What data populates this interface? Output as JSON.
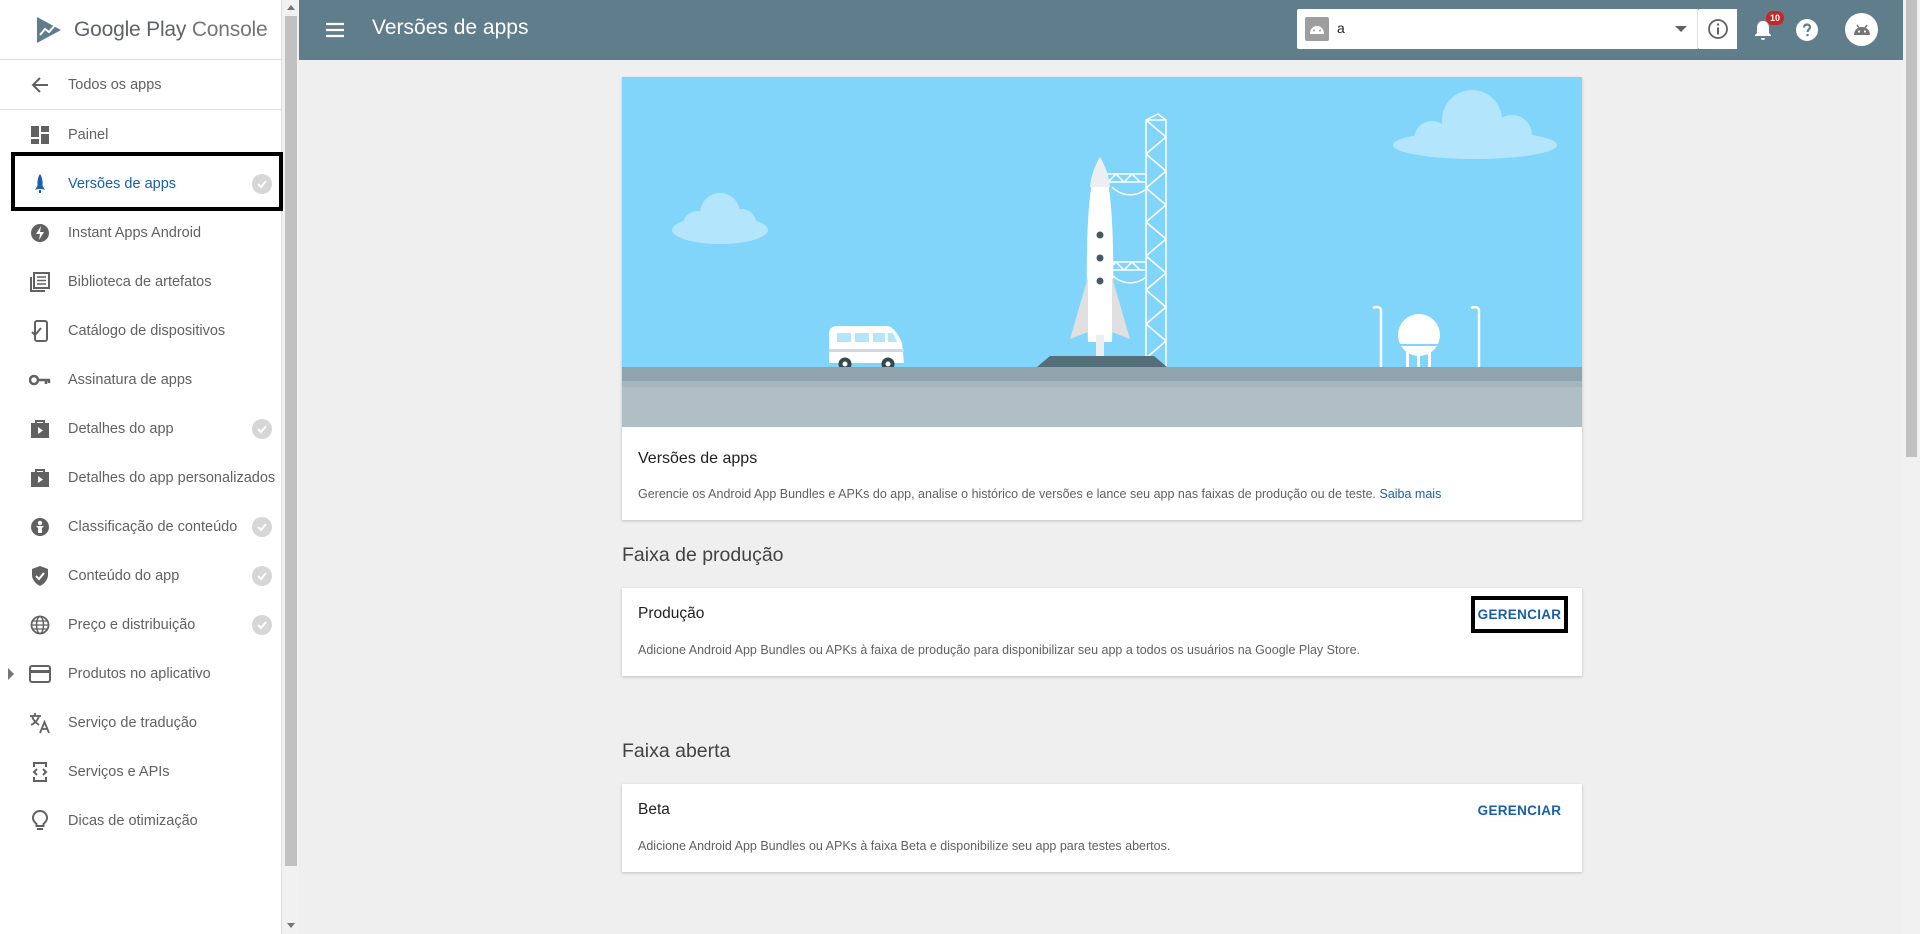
{
  "brand": {
    "name": "Google Play",
    "suffix": "Console"
  },
  "sidebar": {
    "back_label": "Todos os apps",
    "items": [
      {
        "label": "Painel",
        "icon": "dashboard-icon",
        "checked": false
      },
      {
        "label": "Versões de apps",
        "icon": "rocket-icon",
        "checked": true,
        "active": true
      },
      {
        "label": "Instant Apps Android",
        "icon": "bolt-icon",
        "checked": false
      },
      {
        "label": "Biblioteca de artefatos",
        "icon": "library-icon",
        "checked": false
      },
      {
        "label": "Catálogo de dispositivos",
        "icon": "device-catalog-icon",
        "checked": false
      },
      {
        "label": "Assinatura de apps",
        "icon": "key-icon",
        "checked": false
      },
      {
        "label": "Detalhes do app",
        "icon": "store-icon",
        "checked": true
      },
      {
        "label": "Detalhes do app personalizados",
        "icon": "store-icon",
        "checked": false
      },
      {
        "label": "Classificação de conteúdo",
        "icon": "rating-icon",
        "checked": true
      },
      {
        "label": "Conteúdo do app",
        "icon": "shield-icon",
        "checked": true
      },
      {
        "label": "Preço e distribuição",
        "icon": "globe-icon",
        "checked": true
      },
      {
        "label": "Produtos no aplicativo",
        "icon": "card-icon",
        "checked": false,
        "expandable": true
      },
      {
        "label": "Serviço de tradução",
        "icon": "translate-icon",
        "checked": false
      },
      {
        "label": "Serviços e APIs",
        "icon": "api-icon",
        "checked": false
      },
      {
        "label": "Dicas de otimização",
        "icon": "lightbulb-icon",
        "checked": false
      }
    ]
  },
  "header": {
    "title": "Versões de apps",
    "app_selector": {
      "value": "a"
    },
    "notifications_count": "10"
  },
  "hero": {
    "title": "Versões de apps",
    "description": "Gerencie os Android App Bundles e APKs do app, analise o histórico de versões e lance seu app nas faixas de produção ou de teste.",
    "link_label": "Saiba mais"
  },
  "sections": [
    {
      "title": "Faixa de produção",
      "track": {
        "name": "Produção",
        "description": "Adicione Android App Bundles ou APKs à faixa de produção para disponibilizar seu app a todos os usuários na Google Play Store.",
        "action_label": "GERENCIAR"
      }
    },
    {
      "title": "Faixa aberta",
      "track": {
        "name": "Beta",
        "description": "Adicione Android App Bundles ou APKs à faixa Beta e disponibilize seu app para testes abertos.",
        "action_label": "GERENCIAR"
      }
    }
  ],
  "colors": {
    "topbar": "#607d8b",
    "accent_blue": "#1a5fa8",
    "sky": "#81d4fa",
    "ground": "#b0bec5",
    "badge": "#c62828"
  }
}
